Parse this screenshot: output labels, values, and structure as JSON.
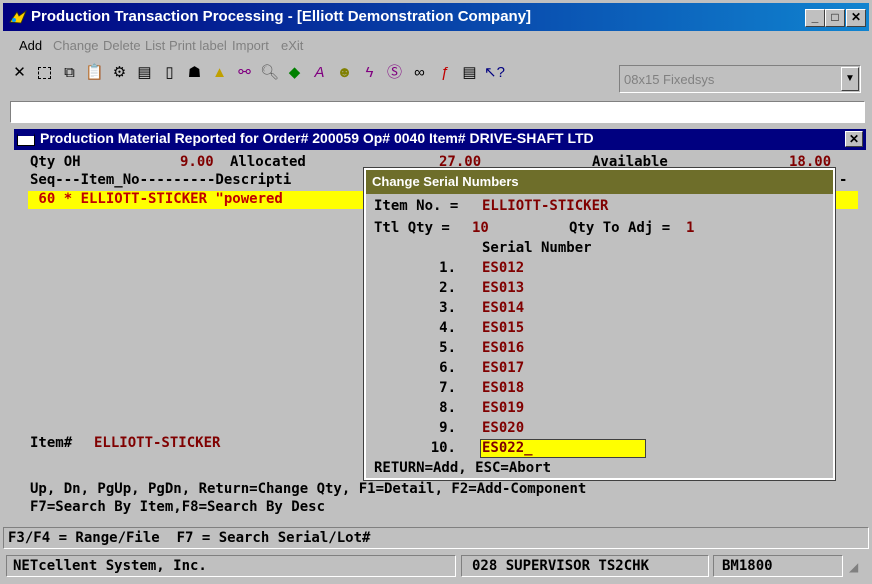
{
  "window": {
    "title": "Production Transaction Processing - [Elliott Demonstration Company]",
    "minimize": "_",
    "maximize": "□",
    "close": "✕"
  },
  "menu": [
    {
      "label": "Add",
      "enabled": true
    },
    {
      "label": "Change",
      "enabled": false
    },
    {
      "label": "Delete",
      "enabled": false
    },
    {
      "label": "List",
      "enabled": false
    },
    {
      "label": "Print label",
      "enabled": false
    },
    {
      "label": "Import",
      "enabled": false
    },
    {
      "label": "eXit",
      "enabled": false
    }
  ],
  "toolbar": {
    "icons": [
      "close-icon",
      "select-icon",
      "copy-icon",
      "paste-icon",
      "settings-icon",
      "properties-icon",
      "note-icon",
      "users-icon",
      "alert-icon",
      "find-icon",
      "zoom-icon",
      "macro-icon",
      "font-icon",
      "help-user-icon",
      "lightning-icon",
      "script-icon",
      "link-icon",
      "function-icon",
      "document-icon",
      "help-cursor-icon"
    ],
    "font_select": "08x15 Fixedsys"
  },
  "inner_window": {
    "title": "Production Material Reported for Order# 200059 Op# 0040 Item# DRIVE-SHAFT LTD",
    "close": "✕"
  },
  "console": {
    "qty_oh_label": "Qty OH",
    "qty_oh_value": "9.00",
    "allocated_label": "Allocated",
    "allocated_value": "27.00",
    "available_label": "Available",
    "available_value": "18.00",
    "header_row": "Seq---Item_No---------Descripti",
    "header_tail": "-",
    "selected_row": " 60 * ELLIOTT-STICKER \"powered",
    "item_label": "Item#",
    "item_value": "ELLIOTT-STICKER",
    "help_line1": "Up, Dn, PgUp, PgDn, Return=Change Qty, F1=Detail, F2=Add-Component",
    "help_line2": "F7=Search By Item,F8=Search By Desc"
  },
  "dialog": {
    "title": "Change Serial Numbers",
    "item_label": "Item No. =",
    "item_value": "ELLIOTT-STICKER",
    "ttl_qty_label": "Ttl Qty =",
    "ttl_qty_value": "10",
    "qty_to_adj_label": "Qty To Adj =",
    "qty_to_adj_value": "1",
    "serial_header": "Serial Number",
    "serials": [
      {
        "num": "1.",
        "serial": "ES012"
      },
      {
        "num": "2.",
        "serial": "ES013"
      },
      {
        "num": "3.",
        "serial": "ES014"
      },
      {
        "num": "4.",
        "serial": "ES015"
      },
      {
        "num": "5.",
        "serial": "ES016"
      },
      {
        "num": "6.",
        "serial": "ES017"
      },
      {
        "num": "7.",
        "serial": "ES018"
      },
      {
        "num": "8.",
        "serial": "ES019"
      },
      {
        "num": "9.",
        "serial": "ES020"
      },
      {
        "num": "10.",
        "serial": "ES022_"
      }
    ],
    "footer": "RETURN=Add, ESC=Abort"
  },
  "function_line": "F3/F4 = Range/File  F7 = Search Serial/Lot#",
  "statusbar": {
    "company": "NETcellent System, Inc.",
    "user": "028 SUPERVISOR TS2CHK",
    "code": "BM1800"
  }
}
